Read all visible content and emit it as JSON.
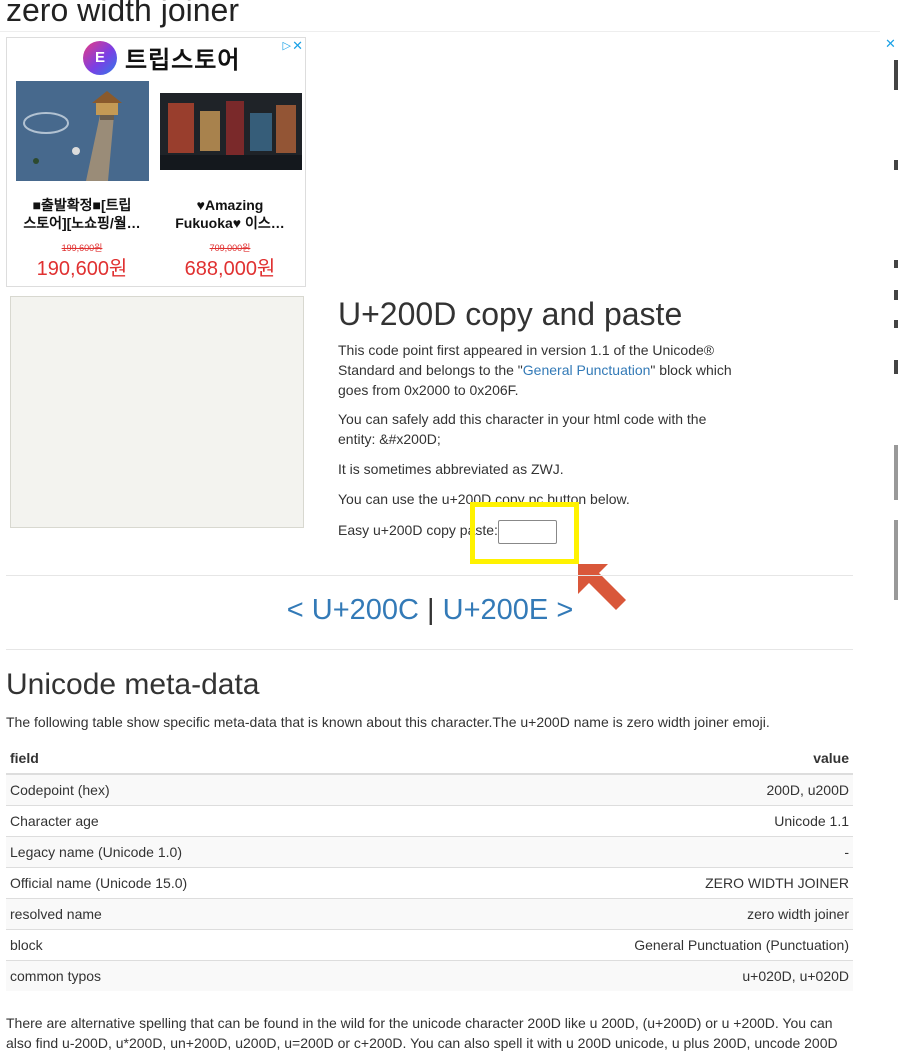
{
  "page": {
    "title": "zero width joiner"
  },
  "ad": {
    "logo_letter": "E",
    "brand": "트립스토어",
    "products": [
      {
        "name_line1": "■출발확정■[트립",
        "name_line2": "스토어][노쇼핑/월…",
        "old_price": "199,600원",
        "price": "190,600원"
      },
      {
        "name_line1": "♥Amazing",
        "name_line2": "Fukuoka♥ 이스…",
        "old_price": "709,000원",
        "price": "688,000원"
      }
    ]
  },
  "char_info": {
    "heading": "U+200D copy and paste",
    "p1_before": "This code point first appeared in version 1.1 of the Unicode® Standard and belongs to the \"",
    "p1_link": "General Punctuation",
    "p1_after": "\" block which goes from 0x2000 to 0x206F.",
    "p2": "You can safely add this character in your html code with the entity: &#x200D;",
    "p3": "It is sometimes abbreviated as ZWJ.",
    "p4": "You can use the u+200D copy pc button below.",
    "easy_label": "Easy u+200D copy paste:",
    "copy_value": ""
  },
  "pager": {
    "prev_arrow": "<",
    "prev": "U+200C",
    "sep": "|",
    "next": "U+200E",
    "next_arrow": ">"
  },
  "meta": {
    "heading": "Unicode meta-data",
    "intro": "The following table show specific meta-data that is known about this character.The u+200D name is zero width joiner emoji.",
    "col_field": "field",
    "col_value": "value",
    "rows": [
      {
        "field": "Codepoint (hex)",
        "value": "200D, u200D"
      },
      {
        "field": "Character age",
        "value": "Unicode 1.1"
      },
      {
        "field": "Legacy name (Unicode 1.0)",
        "value": "-"
      },
      {
        "field": "Official name (Unicode 15.0)",
        "value": "ZERO WIDTH JOINER"
      },
      {
        "field": "resolved name",
        "value": "zero width joiner"
      },
      {
        "field": "block",
        "value": "General Punctuation (Punctuation)"
      },
      {
        "field": "common typos",
        "value": "u+020D, u+020D"
      }
    ]
  },
  "footer": {
    "text": "There are alternative spelling that can be found in the wild for the unicode character 200D like u 200D, (u+200D) or u +200D. You can also find u-200D, u*200D, un+200D, u200D, u=200D or c+200D. You can also spell it with u 200D unicode, u plus 200D, uncode 200D"
  },
  "colors": {
    "link": "#337ab7",
    "highlight": "#fff200",
    "arrow": "#d9573a",
    "price": "#e03131"
  }
}
